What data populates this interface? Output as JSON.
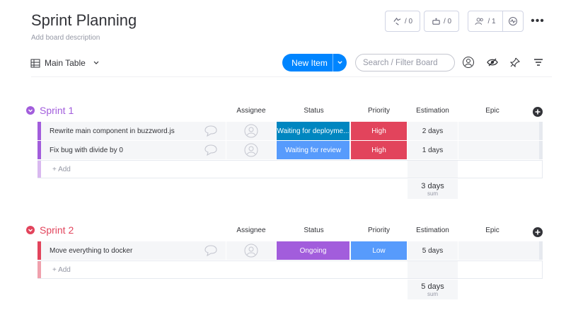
{
  "board": {
    "title": "Sprint Planning",
    "description": "Add board description"
  },
  "header": {
    "activity_count": "/ 0",
    "integrations_count": "/ 0",
    "members_count": "/ 1"
  },
  "toolbar": {
    "view_label": "Main Table",
    "new_item_label": "New Item",
    "search_placeholder": "Search / Filter Board"
  },
  "columns": [
    "Assignee",
    "Status",
    "Priority",
    "Estimation",
    "Epic"
  ],
  "groups": [
    {
      "name": "Sprint 1",
      "color": "#a25ddc",
      "items": [
        {
          "name": "Rewrite main component in buzzword.js",
          "status": "Waiting for deployme...",
          "status_color": "#0086c0",
          "priority": "High",
          "priority_color": "#e2445c",
          "estimation": "2 days"
        },
        {
          "name": "Fix bug with divide by 0",
          "status": "Waiting for review",
          "status_color": "#579bfc",
          "priority": "High",
          "priority_color": "#e2445c",
          "estimation": "1 days"
        }
      ],
      "add_label": "+ Add",
      "sum_value": "3 days",
      "sum_label": "sum"
    },
    {
      "name": "Sprint 2",
      "color": "#e2445c",
      "items": [
        {
          "name": "Move everything to docker",
          "status": "Ongoing",
          "status_color": "#a25ddc",
          "priority": "Low",
          "priority_color": "#579bfc",
          "estimation": "5 days"
        }
      ],
      "add_label": "+ Add",
      "sum_value": "5 days",
      "sum_label": "sum"
    }
  ]
}
